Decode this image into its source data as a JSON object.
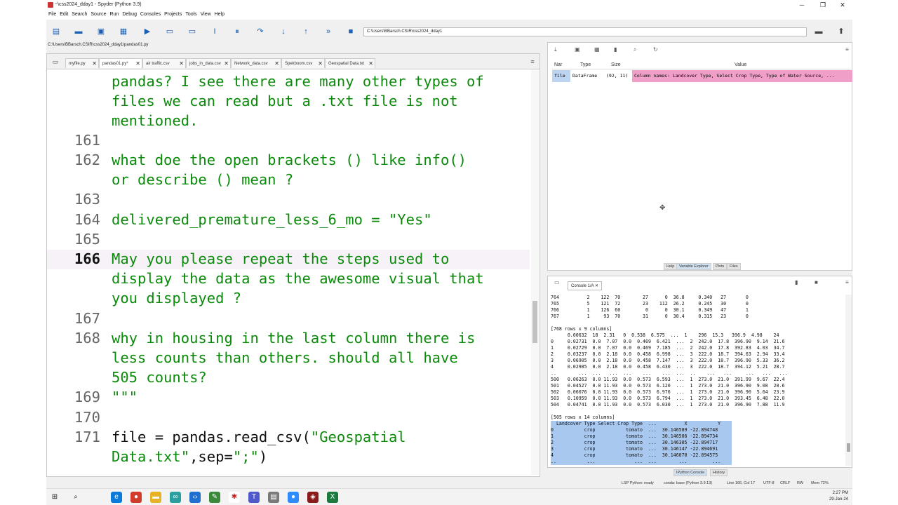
{
  "window": {
    "title": "~\\css2024_dday1 - Spyder (Python 3.9)",
    "min": "─",
    "max": "❐",
    "close": "✕"
  },
  "menu": [
    "File",
    "Edit",
    "Search",
    "Source",
    "Run",
    "Debug",
    "Consoles",
    "Projects",
    "Tools",
    "View",
    "Help"
  ],
  "toolbar": {
    "path": "C:\\Users\\BBarsch.CSIR\\css2024_dday1"
  },
  "editor": {
    "filepath": "C:\\Users\\BBarsch.CSIR\\css2024_dday1\\pandas01.py",
    "tabs": [
      {
        "label": "myfile.py"
      },
      {
        "label": "pandas01.py*"
      },
      {
        "label": "air traffic.csv"
      },
      {
        "label": "jobs_in_data.csv"
      },
      {
        "label": "Network_data.csv"
      },
      {
        "label": "Spekboom.csv"
      },
      {
        "label": "Geospatial Data.txt"
      }
    ],
    "lines": [
      {
        "num": "",
        "text": "pandas? I see there are many other types of"
      },
      {
        "num": "",
        "text": "files we can read but a .txt file is not"
      },
      {
        "num": "",
        "text": "mentioned."
      },
      {
        "num": "161",
        "text": ""
      },
      {
        "num": "162",
        "text": "what doe the open brackets () like info()"
      },
      {
        "num": "",
        "text": "or describe () mean ?"
      },
      {
        "num": "163",
        "text": ""
      },
      {
        "num": "164",
        "text": "delivered_premature_less_6_mo = \"Yes\""
      },
      {
        "num": "165",
        "text": ""
      },
      {
        "num": "166",
        "text": "May you please repeat the steps used to"
      },
      {
        "num": "",
        "text": "display the data as the awesome visual that"
      },
      {
        "num": "",
        "text": "you displayed ?"
      },
      {
        "num": "167",
        "text": ""
      },
      {
        "num": "168",
        "text": "why in housing in the last column there is"
      },
      {
        "num": "",
        "text": "less counts than others. should all have"
      },
      {
        "num": "",
        "text": "505 counts?"
      },
      {
        "num": "169",
        "text": "\"\"\""
      },
      {
        "num": "170",
        "text": ""
      },
      {
        "num": "171",
        "text": "file = pandas.read_csv(\"Geospatial"
      },
      {
        "num": "",
        "text": "Data.txt\",sep=\";\")"
      }
    ]
  },
  "variable_explorer": {
    "headers": {
      "name": "Nar",
      "type": "Type",
      "size": "Size",
      "value": "Value"
    },
    "rows": [
      {
        "name": "file",
        "type": "DataFrame",
        "size": "(92, 11)",
        "value": "Column names: Landcover Type, Select Crop Type, Type of Water Source, ..."
      }
    ],
    "pane_tabs": [
      "Help",
      "Variable Explorer",
      "Plots",
      "Files"
    ]
  },
  "console": {
    "tab_label": "Console 1/A",
    "lines": [
      "764          2    122  70        27      0  36.8     0.340   27       0",
      "765          5    121  72        23    112  26.2     0.245   30       0",
      "766          1    126  60         0      0  30.1     0.349   47       1",
      "767          1     93  70        31      0  30.4     0.315   23       0",
      "",
      "[768 rows x 9 columns]",
      "      0.00632  18  2.31   0  0.538  6.575  ...  1    296  15.3   396.9  4.98    24",
      "0     0.02731  0.0  7.07  0.0  0.469  6.421  ...  2  242.0  17.8  396.90  9.14  21.6",
      "1     0.02729  0.0  7.07  0.0  0.469  7.185  ...  2  242.0  17.8  392.83  4.03  34.7",
      "2     0.03237  0.0  2.18  0.0  0.458  6.998  ...  3  222.0  18.7  394.63  2.94  33.4",
      "3     0.06905  0.0  2.18  0.0  0.458  7.147  ...  3  222.0  18.7  396.90  5.33  36.2",
      "4     0.02985  0.0  2.18  0.0  0.458  6.430  ...  3  222.0  18.7  394.12  5.21  28.7",
      "..        ...  ...   ...  ...    ...    ...  ...  ..    ...   ...     ...   ...   ...",
      "500   0.06263  0.0 11.93  0.0  0.573  6.593  ...  1  273.0  21.0  391.99  9.67  22.4",
      "501   0.04527  0.0 11.93  0.0  0.573  6.120  ...  1  273.0  21.0  396.90  9.08  20.6",
      "502   0.06076  0.0 11.93  0.0  0.573  6.976  ...  1  273.0  21.0  396.90  5.64  23.9",
      "503   0.10959  0.0 11.93  0.0  0.573  6.794  ...  1  273.0  21.0  393.45  6.48  22.0",
      "504   0.04741  0.0 11.93  0.0  0.573  6.030  ...  1  273.0  21.0  396.90  7.88  11.9",
      "",
      "[505 rows x 14 columns]"
    ],
    "selected_lines": [
      "  Landcover Type Select Crop Type  ...          X           Y",
      "0           crop           tomato  ...  30.146589 -22.894748",
      "1           crop           tomato  ...  30.146506 -22.894734",
      "2           crop           tomato  ...  30.146305 -22.894717",
      "3           crop           tomato  ...  30.146147 -22.894691",
      "4           crop           tomato  ...  30.146070 -22.894575",
      "..           ...              ...  ...        ...         ..."
    ],
    "pane_tabs": [
      "IPython Console",
      "History"
    ]
  },
  "statusbar": {
    "lsp": "LSP Python: ready",
    "conda": "conda: base (Python 3.9.13)",
    "position": "Line 166, Col 17",
    "encoding": "UTF-8",
    "eol": "CRLF",
    "rw": "RW",
    "mem": "Mem 72%"
  },
  "taskbar": {
    "time": "2:27 PM",
    "date": "29-Jan-24"
  },
  "colors": {
    "code_text": "#0b8a0b",
    "variable_value_bg": "#f0a0c8",
    "console_selection": "#a9c8ef"
  }
}
